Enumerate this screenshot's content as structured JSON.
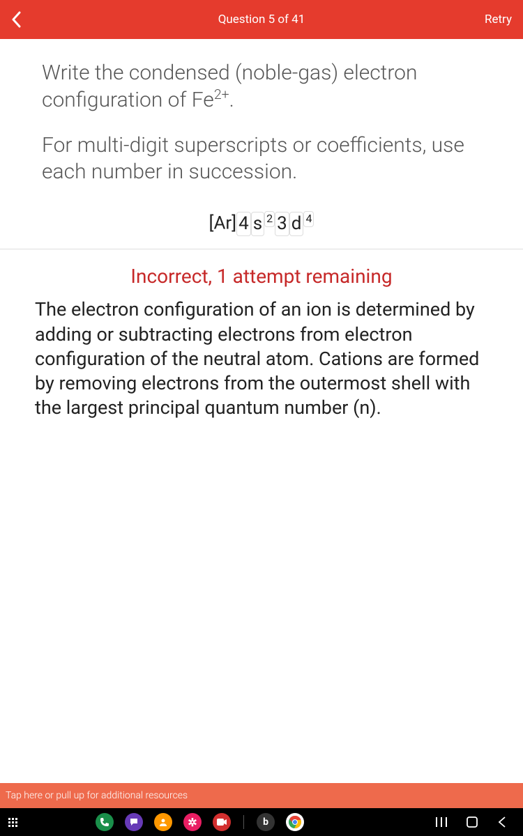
{
  "header": {
    "title": "Question 5 of 41",
    "retry": "Retry"
  },
  "question": {
    "line1_pre": "Write the condensed (noble-gas) electron configuration of Fe",
    "line1_sup": "2+",
    "line1_post": ".",
    "line2": "For multi-digit superscripts or coefficients, use each number in succession."
  },
  "answer": {
    "prefix": "[Ar]",
    "b1": "4",
    "b2": "s",
    "s1": "2",
    "b3": "3",
    "b4": "d",
    "s2": "4"
  },
  "feedback": {
    "title": "Incorrect, 1 attempt remaining",
    "body": "The electron configuration of an ion is determined by adding or subtracting electrons from electron configuration of the neutral atom. Cations are formed by removing electrons from the outermost shell with the largest principal quantum number (n)."
  },
  "pullup": "Tap here or pull up for additional resources",
  "nav": {
    "app_b": "b"
  }
}
